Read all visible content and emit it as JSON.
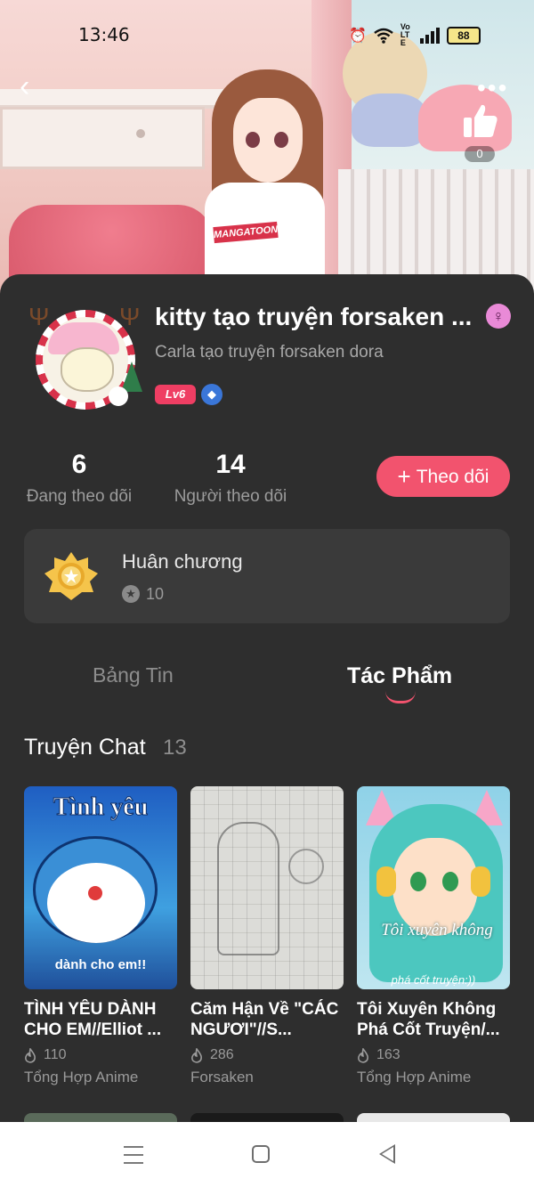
{
  "status_bar": {
    "time": "13:46",
    "battery": "88",
    "network": "VoLTE"
  },
  "header": {
    "like_count": "0"
  },
  "profile": {
    "username": "kitty tạo truyện forsaken ...",
    "bio": "Carla tạo truyện forsaken dora",
    "level": "Lv6",
    "gender_icon": "female-symbol-icon"
  },
  "stats": {
    "following_count": "6",
    "following_label": "Đang theo dõi",
    "followers_count": "14",
    "followers_label": "Người theo dõi"
  },
  "follow_button": {
    "label": "Theo dõi"
  },
  "medal": {
    "title": "Huân chương",
    "count": "10"
  },
  "tabs": [
    {
      "label": "Bảng Tin",
      "active": false
    },
    {
      "label": "Tác Phẩm",
      "active": true
    }
  ],
  "section": {
    "title": "Truyện Chat",
    "count": "13"
  },
  "works": [
    {
      "title": "TÌNH YÊU DÀNH CHO EM//Elliot ...",
      "views": "110",
      "genre": "Tổng Hợp  Anime",
      "cover_text": "Tình yêu",
      "cover_caption": "dành cho em!!"
    },
    {
      "title": "Căm Hận Về \"CÁC NGƯƠI\"//S...",
      "views": "286",
      "genre": "Forsaken"
    },
    {
      "title": "Tôi Xuyên Không Phá Cốt Truyện/...",
      "views": "163",
      "genre": "Tổng Hợp  Anime",
      "cover_text": "Tôi xuyên không",
      "cover_caption": "phá cốt truyện:))"
    }
  ],
  "colors": {
    "accent": "#f2536e",
    "card_bg": "#2e2e2e",
    "level_badge": "#ef3e63"
  }
}
